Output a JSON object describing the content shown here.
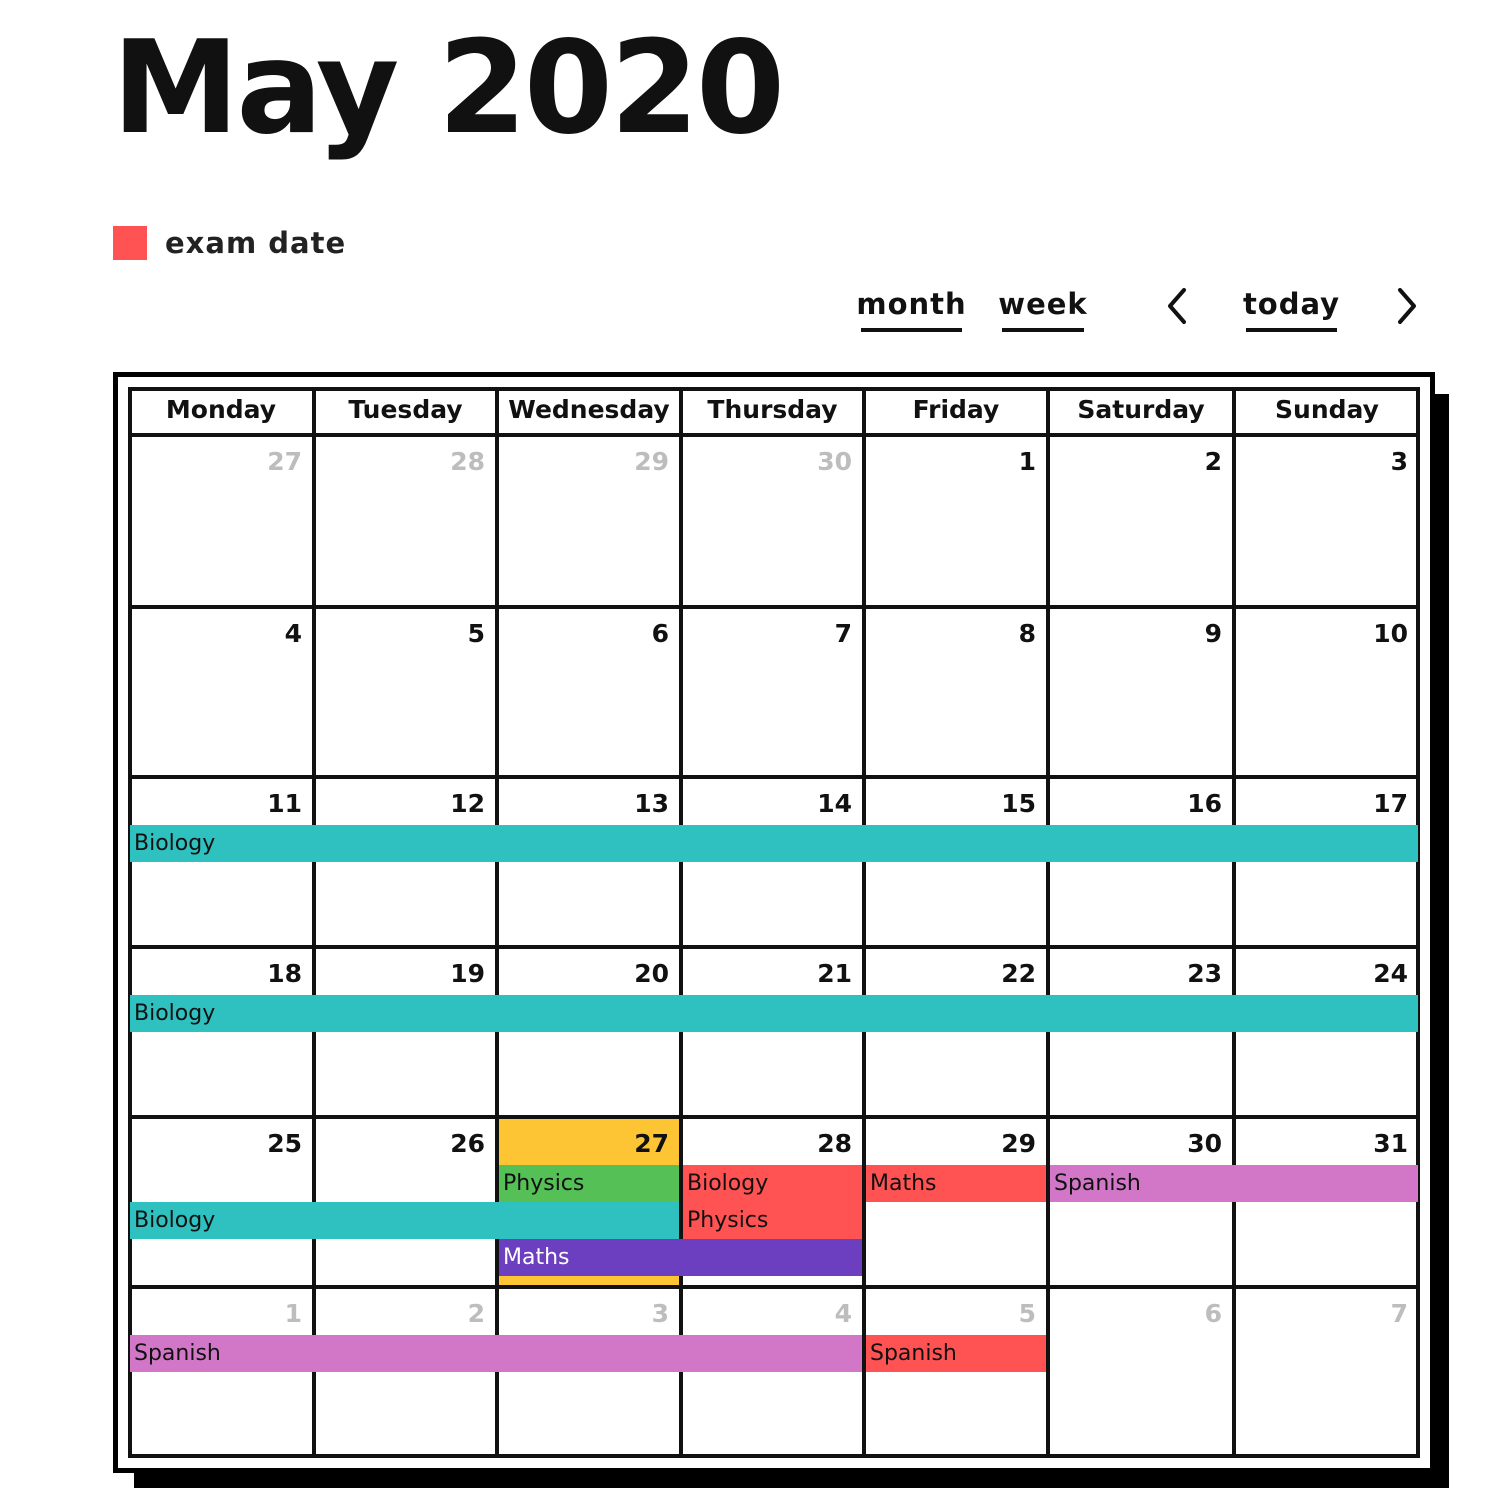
{
  "header": {
    "title": "May 2020"
  },
  "legend": {
    "swatch_color": "#FF5252",
    "label": "exam date"
  },
  "toolbar": {
    "month_label": "month",
    "week_label": "week",
    "prev_icon": "chevron-left-icon",
    "today_label": "today",
    "next_icon": "chevron-right-icon"
  },
  "calendar": {
    "weekdays": [
      "Monday",
      "Tuesday",
      "Wednesday",
      "Thursday",
      "Friday",
      "Saturday",
      "Sunday"
    ],
    "today": {
      "week": 4,
      "day": 2,
      "color": "#FDC534"
    },
    "weeks": [
      {
        "days": [
          {
            "n": "27",
            "other": true
          },
          {
            "n": "28",
            "other": true
          },
          {
            "n": "29",
            "other": true
          },
          {
            "n": "30",
            "other": true
          },
          {
            "n": "1"
          },
          {
            "n": "2"
          },
          {
            "n": "3"
          }
        ]
      },
      {
        "days": [
          {
            "n": "4"
          },
          {
            "n": "5"
          },
          {
            "n": "6"
          },
          {
            "n": "7"
          },
          {
            "n": "8"
          },
          {
            "n": "9"
          },
          {
            "n": "10"
          }
        ]
      },
      {
        "days": [
          {
            "n": "11"
          },
          {
            "n": "12"
          },
          {
            "n": "13"
          },
          {
            "n": "14"
          },
          {
            "n": "15"
          },
          {
            "n": "16"
          },
          {
            "n": "17"
          }
        ]
      },
      {
        "days": [
          {
            "n": "18"
          },
          {
            "n": "19"
          },
          {
            "n": "20"
          },
          {
            "n": "21"
          },
          {
            "n": "22"
          },
          {
            "n": "23"
          },
          {
            "n": "24"
          }
        ]
      },
      {
        "days": [
          {
            "n": "25"
          },
          {
            "n": "26"
          },
          {
            "n": "27"
          },
          {
            "n": "28"
          },
          {
            "n": "29"
          },
          {
            "n": "30"
          },
          {
            "n": "31"
          }
        ]
      },
      {
        "days": [
          {
            "n": "1",
            "other": true
          },
          {
            "n": "2",
            "other": true
          },
          {
            "n": "3",
            "other": true
          },
          {
            "n": "4",
            "other": true
          },
          {
            "n": "5",
            "other": true
          },
          {
            "n": "6",
            "other": true
          },
          {
            "n": "7",
            "other": true
          }
        ]
      }
    ],
    "events": [
      {
        "title": "Biology",
        "week": 2,
        "start": 0,
        "end": 6,
        "slot": 0,
        "color": "#2FC1C0",
        "text_color": "#111111"
      },
      {
        "title": "Biology",
        "week": 3,
        "start": 0,
        "end": 6,
        "slot": 0,
        "color": "#2FC1C0",
        "text_color": "#111111"
      },
      {
        "title": "Physics",
        "week": 4,
        "start": 2,
        "end": 2,
        "slot": 0,
        "color": "#55C055",
        "text_color": "#111111"
      },
      {
        "title": "Biology",
        "week": 4,
        "start": 3,
        "end": 3,
        "slot": 0,
        "color": "#FF5252",
        "text_color": "#111111"
      },
      {
        "title": "Maths",
        "week": 4,
        "start": 4,
        "end": 4,
        "slot": 0,
        "color": "#FF5252",
        "text_color": "#111111"
      },
      {
        "title": "Spanish",
        "week": 4,
        "start": 5,
        "end": 6,
        "slot": 0,
        "color": "#D277C8",
        "text_color": "#111111"
      },
      {
        "title": "Biology",
        "week": 4,
        "start": 0,
        "end": 2,
        "slot": 1,
        "color": "#2FC1C0",
        "text_color": "#111111"
      },
      {
        "title": "Physics",
        "week": 4,
        "start": 3,
        "end": 3,
        "slot": 1,
        "color": "#FF5252",
        "text_color": "#111111"
      },
      {
        "title": "Maths",
        "week": 4,
        "start": 2,
        "end": 3,
        "slot": 2,
        "color": "#6B3FBF",
        "text_color": "#FFFFFF"
      },
      {
        "title": "Spanish",
        "week": 5,
        "start": 0,
        "end": 3,
        "slot": 0,
        "color": "#D277C8",
        "text_color": "#111111"
      },
      {
        "title": "Spanish",
        "week": 5,
        "start": 4,
        "end": 4,
        "slot": 0,
        "color": "#FF5252",
        "text_color": "#111111"
      }
    ]
  }
}
